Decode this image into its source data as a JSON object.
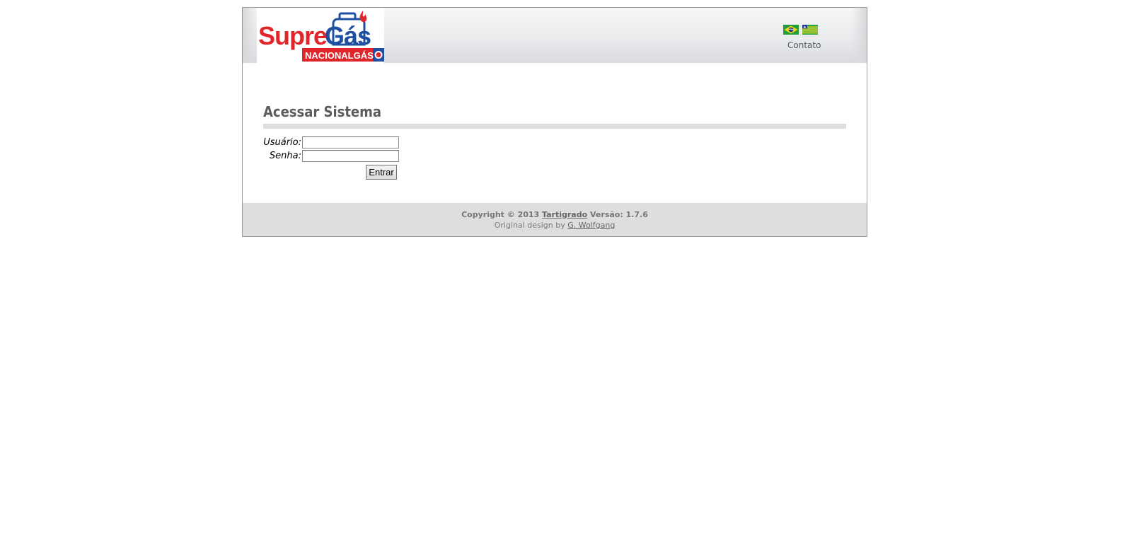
{
  "brand": {
    "logo_word_1": "Supre",
    "logo_word_2": "Gás",
    "logo_banner": "NACIONALGÁS",
    "colors": {
      "red": "#e0262b",
      "blue": "#1e4fa0"
    }
  },
  "header": {
    "flags": [
      {
        "icon": "brazil-flag-icon"
      },
      {
        "icon": "piaui-flag-icon"
      }
    ],
    "contact_link": "Contato"
  },
  "main": {
    "title": "Acessar Sistema",
    "login_form": {
      "username_label": "Usuário:",
      "username_value": "",
      "password_label": "Senha:",
      "password_value": "",
      "submit_label": "Entrar"
    }
  },
  "footer": {
    "copyright_prefix": "Copyright © 2013",
    "company_link": "Tartigrado",
    "version_text": "Versão: 1.7.6",
    "design_prefix": "Original design by",
    "designer_link": "G. Wolfgang"
  }
}
